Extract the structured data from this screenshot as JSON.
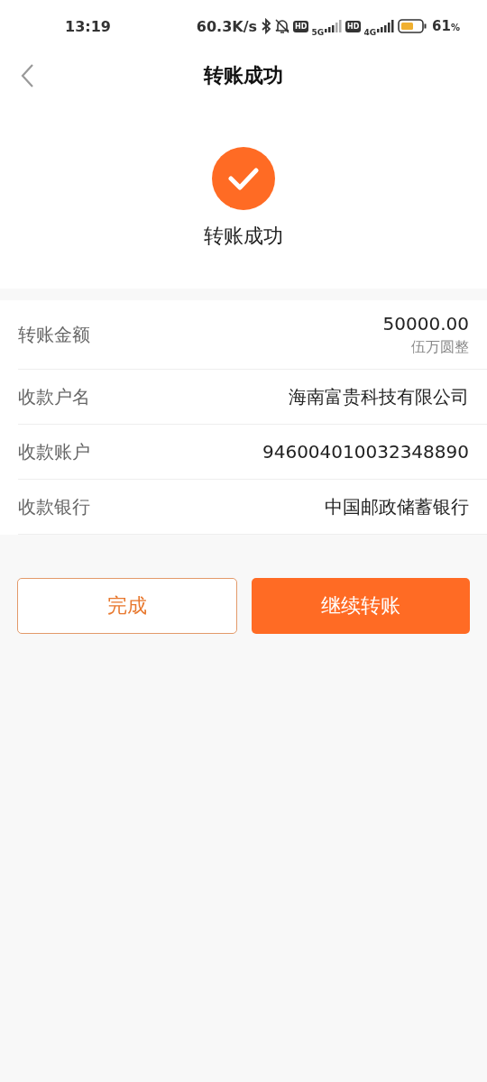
{
  "status_bar": {
    "time": "13:19",
    "speed": "60.3K/s",
    "sim1_badge": "HD",
    "sim1_network": "5G",
    "sim2_badge": "HD",
    "sim2_network": "4G",
    "battery": "61",
    "battery_unit": "%"
  },
  "header": {
    "title": "转账成功"
  },
  "result": {
    "message": "转账成功"
  },
  "details": [
    {
      "label": "转账金额",
      "value": "50000.00",
      "note": "伍万圆整"
    },
    {
      "label": "收款户名",
      "value": "海南富贵科技有限公司"
    },
    {
      "label": "收款账户",
      "value": "946004010032348890"
    },
    {
      "label": "收款银行",
      "value": "中国邮政储蓄银行"
    }
  ],
  "buttons": [
    {
      "label": "完成",
      "kind": "outline"
    },
    {
      "label": "继续转账",
      "kind": "filled"
    }
  ]
}
